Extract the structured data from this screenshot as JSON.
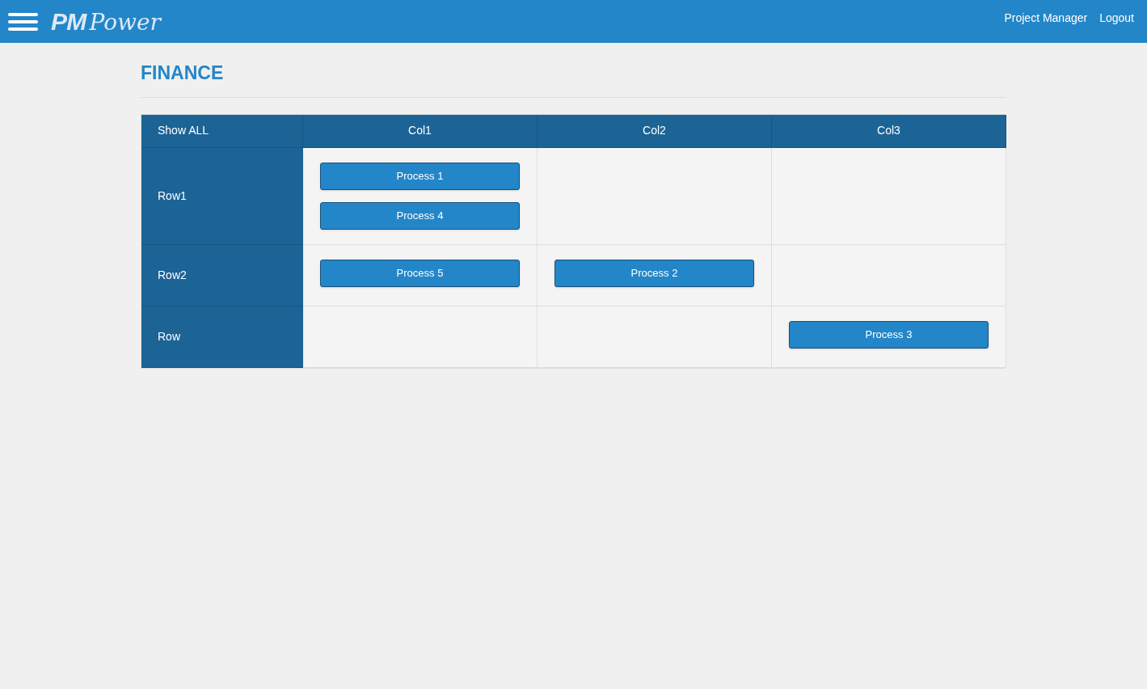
{
  "header": {
    "logo": {
      "initials": "PM",
      "word": "Power"
    },
    "links": [
      "Project Manager",
      "Logout"
    ]
  },
  "page": {
    "title": "FINANCE"
  },
  "table": {
    "corner": "Show ALL",
    "columns": [
      "Col1",
      "Col2",
      "Col3"
    ],
    "rows": [
      {
        "label": "Row1",
        "cells": [
          [
            "Process 1",
            "Process 4"
          ],
          [],
          []
        ]
      },
      {
        "label": "Row2",
        "cells": [
          [
            "Process 5"
          ],
          [
            "Process 2"
          ],
          []
        ]
      },
      {
        "label": "Row",
        "cells": [
          [],
          [],
          [
            "Process 3"
          ]
        ]
      }
    ]
  }
}
